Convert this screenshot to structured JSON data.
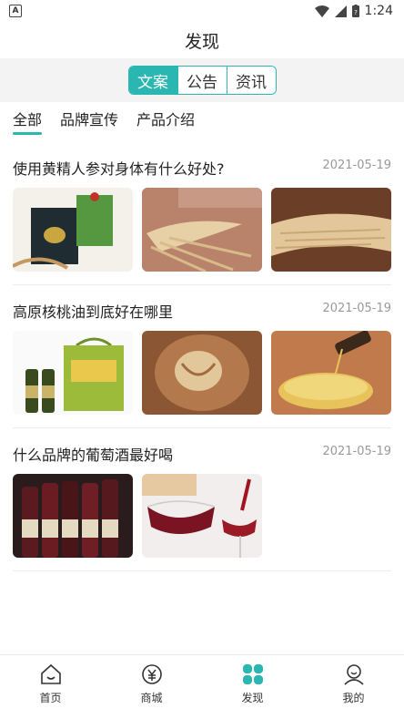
{
  "status": {
    "time": "1:24"
  },
  "header": {
    "title": "发现"
  },
  "segments": [
    {
      "label": "文案",
      "active": true
    },
    {
      "label": "公告",
      "active": false
    },
    {
      "label": "资讯",
      "active": false
    }
  ],
  "categories": [
    {
      "label": "全部",
      "active": true
    },
    {
      "label": "品牌宣传",
      "active": false
    },
    {
      "label": "产品介绍",
      "active": false
    }
  ],
  "articles": [
    {
      "title": "使用黄精人参对身体有什么好处?",
      "date": "2021-05-19",
      "images": [
        "ginseng-gift-box",
        "ginseng-root",
        "ginseng-roots-on-wood"
      ]
    },
    {
      "title": "高原核桃油到底好在哪里",
      "date": "2021-05-19",
      "images": [
        "walnut-oil-gift-box",
        "walnut-kernels",
        "oil-pouring"
      ]
    },
    {
      "title": "什么品牌的葡萄酒最好喝",
      "date": "2021-05-19",
      "images": [
        "wine-bottles",
        "wine-glasses"
      ]
    }
  ],
  "tabbar": [
    {
      "label": "首页",
      "icon": "home-icon",
      "active": false
    },
    {
      "label": "商城",
      "icon": "shop-icon",
      "active": false
    },
    {
      "label": "发现",
      "icon": "discover-icon",
      "active": true
    },
    {
      "label": "我的",
      "icon": "profile-icon",
      "active": false
    }
  ],
  "colors": {
    "accent": "#2ab7b1"
  }
}
